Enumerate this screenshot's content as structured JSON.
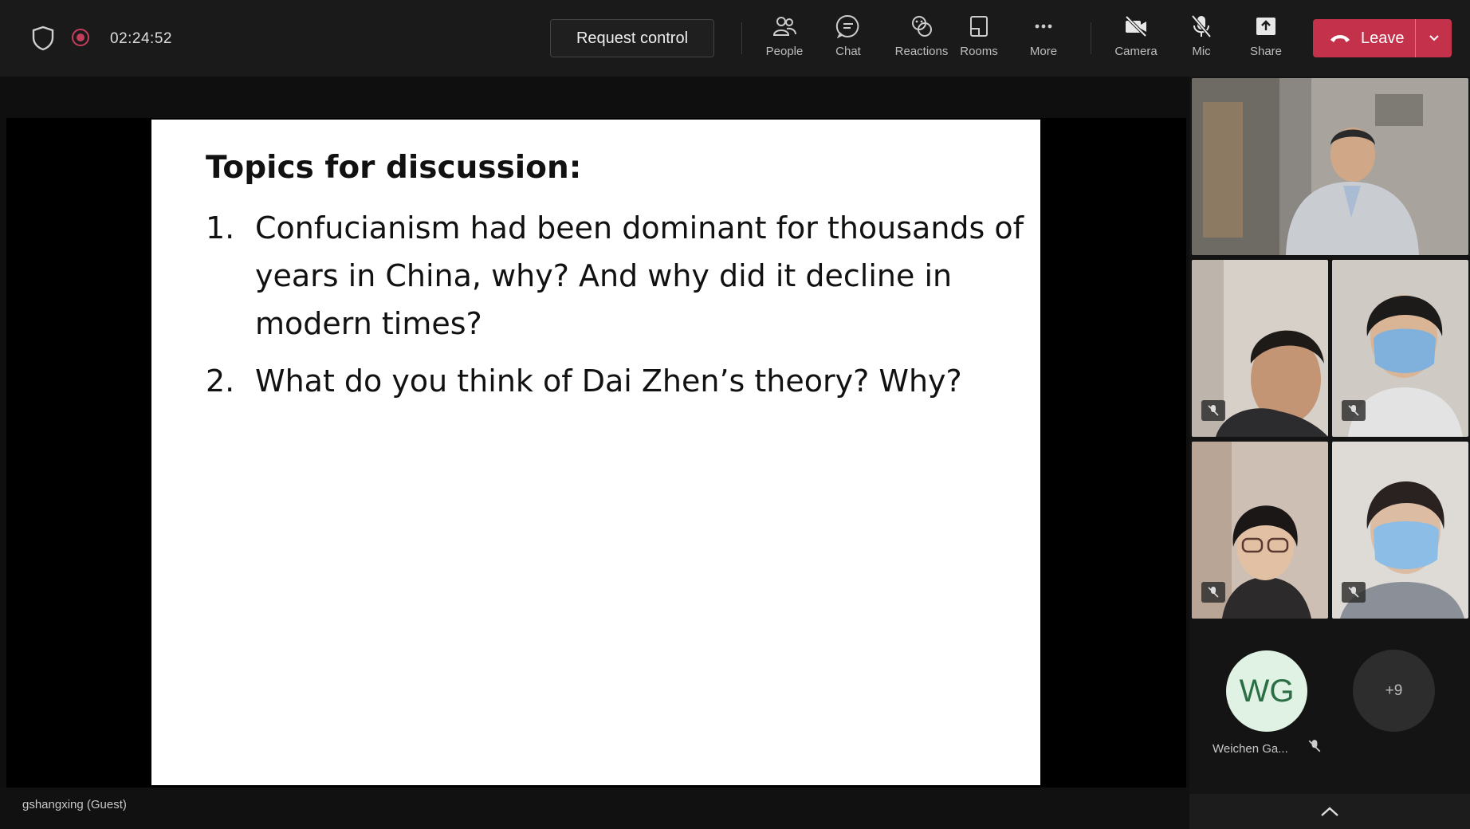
{
  "call": {
    "timer": "02:24:52",
    "request_control_label": "Request control"
  },
  "toolbar": {
    "people_label": "People",
    "chat_label": "Chat",
    "reactions_label": "Reactions",
    "rooms_label": "Rooms",
    "more_label": "More",
    "camera_label": "Camera",
    "mic_label": "Mic",
    "share_label": "Share",
    "leave_label": "Leave"
  },
  "slide": {
    "title": "Topics for discussion:",
    "items": [
      {
        "number": "1.",
        "text": "Confucianism had been dominant for thousands of years in China, why? And why did it decline in modern times?"
      },
      {
        "number": "2.",
        "text": "What do you think of Dai Zhen’s theory? Why?"
      }
    ]
  },
  "presenter_label": "gshangxing (Guest)",
  "participants": {
    "avatar_initials": "WG",
    "avatar_name": "Weichen Ga...",
    "overflow_count": "+9"
  },
  "colors": {
    "leave_button": "#c4314b",
    "recording_dot": "#c43e5c",
    "avatar_bg": "#dff2e4",
    "avatar_text": "#2c6e44"
  },
  "icons": {
    "shield": "shield-icon",
    "record": "record-icon",
    "people": "people-icon",
    "chat": "chat-icon",
    "reactions": "reactions-icon",
    "rooms": "rooms-icon",
    "more": "more-icon",
    "camera_off": "camera-off-icon",
    "mic_off": "mic-off-icon",
    "share": "share-icon",
    "hang_up": "phone-hangup-icon",
    "chevron_down": "chevron-down-icon",
    "chevron_up": "chevron-up-icon"
  }
}
